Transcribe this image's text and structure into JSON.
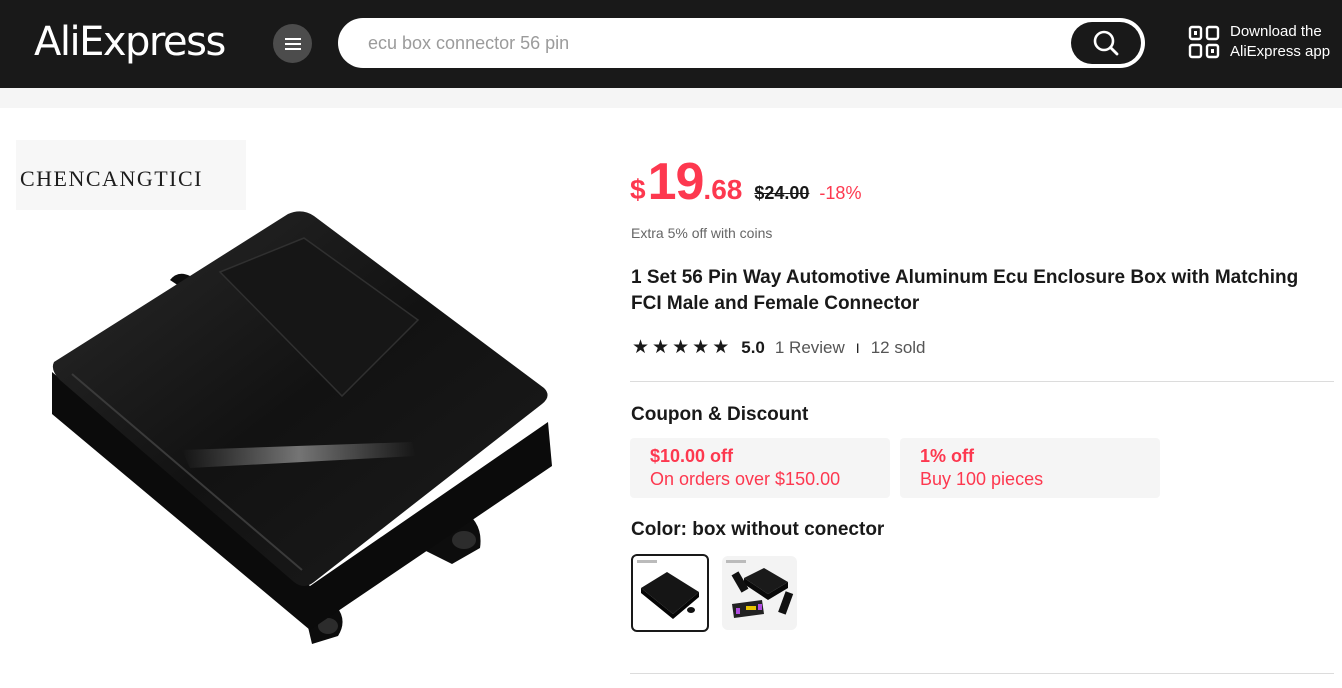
{
  "header": {
    "logo": "AliExpress",
    "search": {
      "value": "",
      "placeholder": "ecu box connector 56 pin"
    },
    "app_download": {
      "line1": "Download the",
      "line2": "AliExpress app"
    }
  },
  "gallery": {
    "brand_watermark": "CHENCANGTICI"
  },
  "price": {
    "currency": "$",
    "integer": "19",
    "decimal": ".68",
    "original": "$24.00",
    "discount": "-18%",
    "coins_note": "Extra 5% off with coins"
  },
  "product": {
    "title": "1 Set 56 Pin Way Automotive Aluminum Ecu Enclosure Box with Matching FCI Male and Female Connector",
    "rating": {
      "stars": 5,
      "score": "5.0",
      "reviews": "1 Review",
      "separator": "I",
      "sold": "12 sold"
    }
  },
  "coupons": {
    "heading": "Coupon & Discount",
    "items": [
      {
        "title": "$10.00 off",
        "detail": "On orders over $150.00"
      },
      {
        "title": "1% off",
        "detail": "Buy 100 pieces"
      }
    ]
  },
  "color": {
    "heading": "Color: box without conector",
    "selected_index": 0,
    "options": [
      "box without conector",
      "box with conector"
    ]
  },
  "colors": {
    "accent": "#fd384f",
    "header_bg": "#191919",
    "panel_bg": "#f5f5f5"
  }
}
